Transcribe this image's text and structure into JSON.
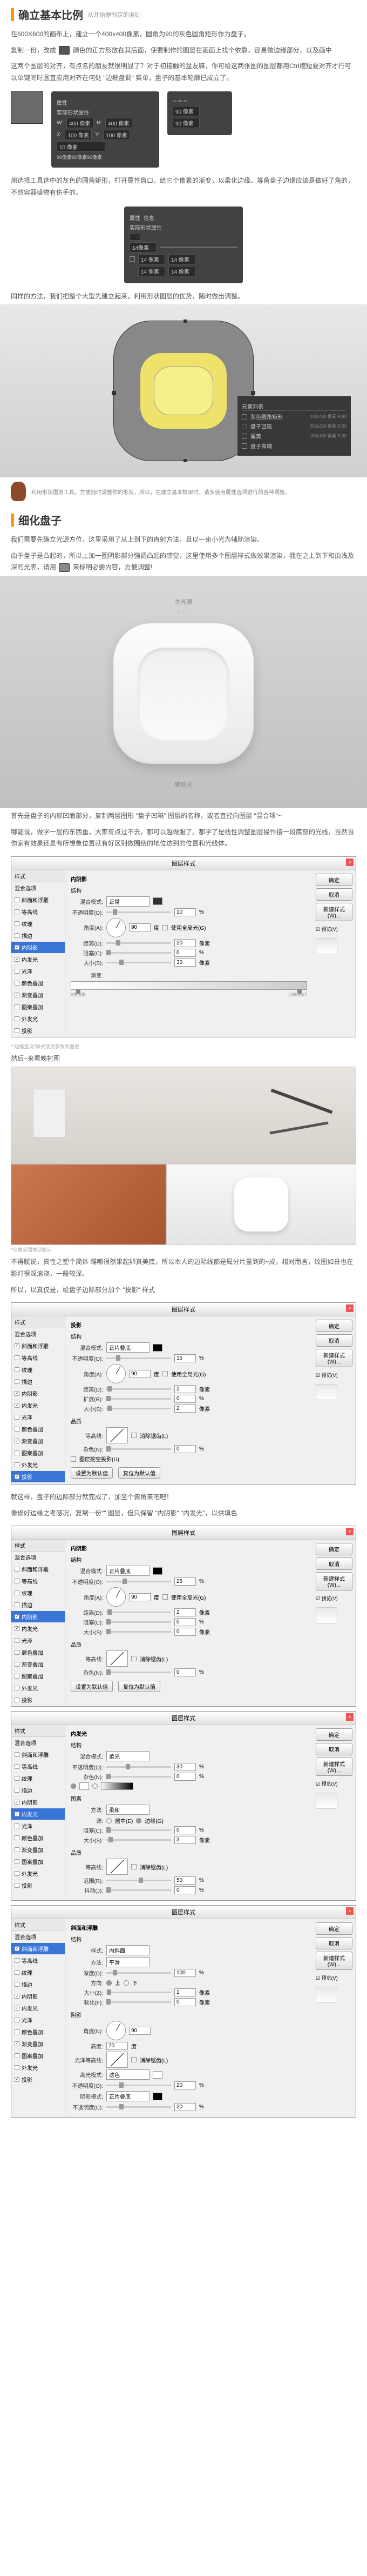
{
  "sections": {
    "s1": {
      "title": "确立基本比例",
      "subtitle": "从开始便制定的准则"
    },
    "s2": {
      "title": "细化盘子"
    }
  },
  "paragraphs": {
    "p1": "在600X600的画布上，建立一个400x400像素，圆角为90的灰色圆角矩形作为盘子。",
    "p2a": "复制一份，改成",
    "p2b": "颜色的正方形放在其后面，使要制作的图层在画面上找个依靠，容易做边缘部分，以及画中",
    "p3": "这两个图层的对齐，有点名的朋友就很明显了？对于初接触的盆友嘛，你可给这两张图的图层都用Ctrl缩短要对齐才行可以单键同时圆直应用对齐在何处 \"边框盘调\" 菜单，盘子的基本轮廓已成立了。",
    "p4": "用选择工具选中的灰色的圆角矩形，打开属性窗口，给它个像素的渐变，以柔化边缘。等角盘子边缘应该是做好了角的，不然容器盛物有伤手的。",
    "p5": "同样的方法，我们把整个大型先建立起来，利用形状图层的优势，随时做出调整。",
    "p6": "我们需要先确立光源方位，这里采用了从上到下的直射方法，且以一束小光为辅助渲染。",
    "p7": "由于盘子是凸起的，所以上加一圈阴影部分强调凸起的感觉，这里使用多个图层样式做效果渲染，我在之上到下和由浅及深的光表，请用",
    "p7b": "来标明必要内容，方便调整!",
    "p8": "首先是盘子的内部凹面部分，复制两层图形 \"盘子凹陷\" 图层的名称，或者直径向图层 \"混合项\"~",
    "p9": "哪能说，做学一层的东西重，大家有点过不去，都可以越做服了。都学了是线性调整图层操作接一段底部的光线，当然当你家有效果还是有所想象位置就有好区别做围绕的地位达到的位置和光线体。",
    "p10": "然后~来看映衬图",
    "p11": "不得腻说，真性之塑个简体 瞄哪很然果起卵真美底，所以本人的边际线都是属分片量到的~成，相对而言，纹图如日也在影灯很深滚浇，一般较深。",
    "p12": "所以，以真仅是，给盘子边际部分加个 \"投影\" 样式",
    "p13": "就这样，盘子的边际部分就完成了，加至个俯角来吧吧！",
    "p14": "像修好边缘之考感况，复制一份\"\" 图层，但只保留 \"内阴影\" \"内发光\"，以供填色"
  },
  "ps_props_panel": {
    "header": "属性",
    "shape_label": "实际形状属性",
    "wh": {
      "w_label": "W:",
      "w_val": "400 像素",
      "h_label": "H:",
      "h_val": "400 像素"
    },
    "xy": {
      "x_label": "X:",
      "x_val": "100 像素",
      "y_label": "Y:",
      "y_val": "100 像素"
    },
    "border_val": "10 像素",
    "corner_val": "90像素90像素90像素",
    "corner_single": "90 像素"
  },
  "ps_props_panel2": {
    "border_val": "14像素",
    "lock": "☑",
    "r": "14 像素"
  },
  "element_list": {
    "header": "元素列表",
    "i1": {
      "label": "灰色圆角矩形",
      "dim": "400x400 像素 R:90"
    },
    "i2": {
      "label": "盘子凹陷",
      "dim": "250x250 像素 R:50"
    },
    "i3": {
      "label": "蛋黄",
      "dim": "180x180 像素 R:30"
    },
    "i4": {
      "label": "盘子高端"
    }
  },
  "mascot_text": "利用形状图层工具，方便随时调整你的形状，所以，在建立基本框架时，请多使用属性选项进行的各种调整。",
  "plate": {
    "top_label": "主光源",
    "arrows_top": "↓↓↓",
    "bottom_label": "辅助光",
    "arrows_bottom": "↑↑↑"
  },
  "layer_style": {
    "title": "图层样式",
    "sidebar_header": "样式",
    "buttons": {
      "ok": "确定",
      "cancel": "取消",
      "new": "新建样式(W)...",
      "preview": "☑ 预览(V)"
    },
    "items": {
      "blend": "混合选项",
      "bevel": "斜面和浮雕",
      "contour": "等高线",
      "texture": "纹理",
      "stroke": "描边",
      "inner_shadow": "内阴影",
      "inner_glow": "内发光",
      "satin": "光泽",
      "color_overlay": "颜色叠加",
      "gradient_overlay": "渐变叠加",
      "pattern_overlay": "图案叠加",
      "outer_glow": "外发光",
      "drop_shadow": "投影"
    }
  },
  "inner_shadow_form": {
    "section": "内阴影",
    "struct": "结构",
    "blend_mode": {
      "label": "混合模式:",
      "value": "正常"
    },
    "opacity": {
      "label": "不透明度(O):",
      "value": "10",
      "unit": "%"
    },
    "angle": {
      "label": "角度(A):",
      "value": "90",
      "unit": "度",
      "global": "使用全局光(G)"
    },
    "distance": {
      "label": "距离(D):",
      "value": "20",
      "unit": "像素"
    },
    "choke": {
      "label": "阻塞(C):",
      "value": "0",
      "unit": "%"
    },
    "size": {
      "label": "大小(S):",
      "value": "30",
      "unit": "像素"
    },
    "quality": "品质",
    "contour": {
      "label": "等高线:",
      "anti": "消除锯齿(L)"
    },
    "noise": {
      "label": "杂色(N):",
      "value": "0",
      "unit": "%"
    },
    "defaults": {
      "set": "设置为默认值",
      "reset": "复位为默认值"
    }
  },
  "gradient_form": {
    "gradient_label": "渐变:",
    "stops": {
      "left": "#f5f5f5",
      "right": "#d5d5d7"
    }
  },
  "drop_shadow_form": {
    "section": "投影",
    "struct": "结构",
    "blend_mode": {
      "label": "混合模式:",
      "value": "正片叠底"
    },
    "opacity": {
      "label": "不透明度(O):",
      "value": "15",
      "unit": "%"
    },
    "angle": {
      "label": "角度(A):",
      "value": "90",
      "unit": "度",
      "global": "使用全局光(G)"
    },
    "distance": {
      "label": "距离(D):",
      "value": "2",
      "unit": "像素"
    },
    "spread": {
      "label": "扩展(R):",
      "value": "0",
      "unit": "%"
    },
    "size": {
      "label": "大小(S):",
      "value": "2",
      "unit": "像素"
    },
    "knockout": "图层挖空投影(U)"
  },
  "inner_glow_form": {
    "section": "内发光",
    "struct": "结构",
    "blend_mode": {
      "label": "混合模式:",
      "value": "柔光"
    },
    "opacity": {
      "label": "不透明度(O):",
      "value": "30",
      "unit": "%"
    },
    "noise": {
      "label": "杂色(N):",
      "value": "0",
      "unit": "%"
    },
    "elements": "图素",
    "technique": {
      "label": "方法:",
      "value": "柔和"
    },
    "source": {
      "label": "源:",
      "center": "居中(E)",
      "edge": "边缘(G)"
    },
    "choke": {
      "label": "阻塞(C):",
      "value": "0",
      "unit": "%"
    },
    "size": {
      "label": "大小(S):",
      "value": "3",
      "unit": "像素"
    },
    "quality": "品质",
    "range": {
      "label": "范围(R):",
      "value": "50",
      "unit": "%"
    },
    "jitter": {
      "label": "抖动(J):",
      "value": "0",
      "unit": "%"
    }
  },
  "inner_shadow2": {
    "opacity": {
      "value": "25"
    },
    "distance": {
      "value": "2"
    },
    "size": {
      "value": "0"
    }
  },
  "bevel_form": {
    "section": "斜面和浮雕",
    "struct": "结构",
    "style": {
      "label": "样式:",
      "value": "内斜面"
    },
    "technique": {
      "label": "方法:",
      "value": "平滑"
    },
    "depth": {
      "label": "深度(D):",
      "value": "100",
      "unit": "%"
    },
    "direction": {
      "label": "方向:",
      "up": "上",
      "down": "下"
    },
    "size": {
      "label": "大小(Z):",
      "value": "1",
      "unit": "像素"
    },
    "soften": {
      "label": "软化(F):",
      "value": "0",
      "unit": "像素"
    },
    "shading": "阴影",
    "angle": {
      "label": "角度(N):",
      "value": "90"
    },
    "altitude": {
      "label": "高度:",
      "value": "70",
      "unit": "度"
    },
    "gloss_contour": {
      "label": "光泽等高线:",
      "anti": "消除锯齿(L)"
    },
    "highlight": {
      "label": "高光模式:",
      "value": "滤色",
      "opacity_label": "不透明度(O):",
      "opacity": "20",
      "unit": "%"
    },
    "shadow": {
      "label": "阴影模式:",
      "value": "正片叠底",
      "opacity_label": "不透明度(C):",
      "opacity": "20",
      "unit": "%"
    }
  },
  "caption1": "*\"边框盘调\"样式使用参数效图层",
  "caption2": "*仅做范围体现载示"
}
